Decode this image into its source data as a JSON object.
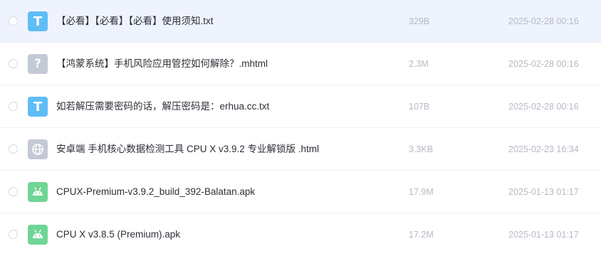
{
  "files": [
    {
      "name": "【必看】【必看】【必看】使用须知.txt",
      "size": "329B",
      "date": "2025-02-28 00:16",
      "icon": "text-file-icon",
      "icon_letter": "T"
    },
    {
      "name": "【鸿蒙系统】手机风险应用管控如何解除？.mhtml",
      "size": "2.3M",
      "date": "2025-02-28 00:16",
      "icon": "unknown-file-icon",
      "icon_letter": "?"
    },
    {
      "name": "如若解压需要密码的话，解压密码是：erhua.cc.txt",
      "size": "107B",
      "date": "2025-02-28 00:16",
      "icon": "text-file-icon",
      "icon_letter": "T"
    },
    {
      "name": "安卓端 手机核心数据检测工具 CPU X v3.9.2 专业解锁版 .html",
      "size": "3.3KB",
      "date": "2025-02-23 16:34",
      "icon": "globe-icon"
    },
    {
      "name": "CPUX-Premium-v3.9.2_build_392-Balatan.apk",
      "size": "17.9M",
      "date": "2025-01-13 01:17",
      "icon": "android-icon"
    },
    {
      "name": "CPU X v3.8.5 (Premium).apk",
      "size": "17.2M",
      "date": "2025-01-13 01:17",
      "icon": "android-icon"
    }
  ],
  "colors": {
    "hover_row": "#eef3fe",
    "txt_icon": "#5fbdf6",
    "apk_icon": "#6fd594",
    "gray_icon": "#c4c9d6"
  }
}
